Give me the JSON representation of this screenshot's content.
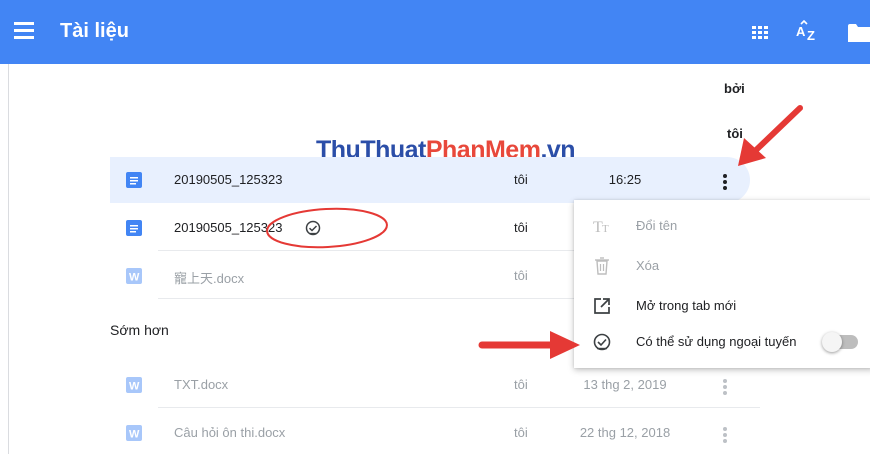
{
  "app": {
    "title": "Tài liệu"
  },
  "toolbar": {
    "grid_icon": "grid-view-icon",
    "sort_icon": "sort-az-icon",
    "folder_icon": "folder-icon"
  },
  "columns": {
    "by_line1": "bởi",
    "by_line2": "tôi"
  },
  "watermark": {
    "part1": "ThuThuat",
    "part2": "PhanMem",
    "part3": ".vn"
  },
  "files_recent": [
    {
      "name": "20190505_125323",
      "owner": "tôi",
      "date": "16:25",
      "type": "docs",
      "selected": true
    },
    {
      "name": "20190505_125323",
      "owner": "tôi",
      "date": "",
      "type": "docs",
      "offline": true
    },
    {
      "name": "寵上天.docx",
      "owner": "tôi",
      "date": "",
      "type": "word",
      "dimmed": true
    }
  ],
  "section_earlier": "Sớm hơn",
  "files_earlier": [
    {
      "name": "TXT.docx",
      "owner": "tôi",
      "date": "13 thg 2, 2019",
      "type": "word",
      "dimmed": true
    },
    {
      "name": "Câu hỏi ôn thi.docx",
      "owner": "tôi",
      "date": "22 thg 12, 2018",
      "type": "word",
      "dimmed": true
    }
  ],
  "context_menu": {
    "items": [
      {
        "label": "Đổi tên",
        "icon": "text-format-icon",
        "disabled": true
      },
      {
        "label": "Xóa",
        "icon": "trash-icon",
        "disabled": true
      },
      {
        "label": "Mở trong tab mới",
        "icon": "open-in-new-icon",
        "disabled": false
      },
      {
        "label": "Có thể sử dụng ngoại tuyến",
        "icon": "offline-check-icon",
        "disabled": false,
        "toggle": false
      }
    ]
  },
  "colors": {
    "header": "#4285f4",
    "docs_icon": "#4285f4",
    "word_icon_dimmed": "#a8c7fa",
    "selected_row": "#e8f0fe",
    "annotation": "#e53935"
  }
}
